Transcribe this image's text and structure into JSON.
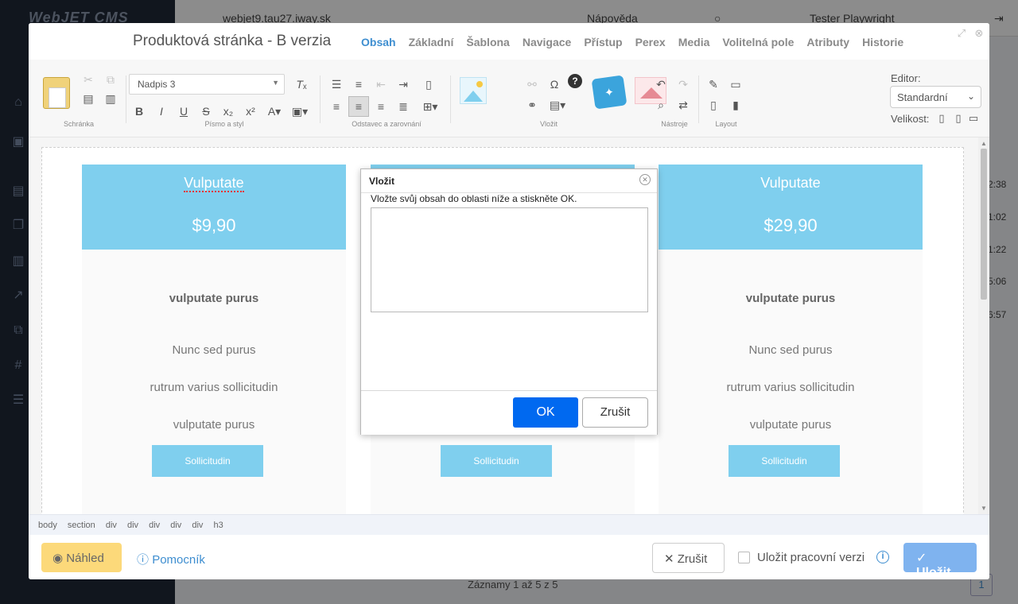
{
  "background": {
    "logo": "WebJET CMS",
    "host": "webjet9.tau27.iway.sk",
    "help": "Nápověda",
    "user": "Tester Playwright",
    "row_times": [
      "2:38",
      "1:02",
      "1:22",
      "5:06",
      "6:57"
    ],
    "records": "Záznamy 1 až 5 z 5",
    "page_number": "1"
  },
  "modal": {
    "title": "Produktová stránka - B verzia",
    "tabs": [
      {
        "label": "Obsah",
        "active": true
      },
      {
        "label": "Základní"
      },
      {
        "label": "Šablona"
      },
      {
        "label": "Navigace"
      },
      {
        "label": "Přístup"
      },
      {
        "label": "Perex"
      },
      {
        "label": "Media"
      },
      {
        "label": "Volitelná pole"
      },
      {
        "label": "Atributy"
      },
      {
        "label": "Historie"
      }
    ]
  },
  "toolbar": {
    "groups": {
      "clipboard": "Schránka",
      "font": "Písmo a styl",
      "paragraph": "Odstavec a zarovnání",
      "insert": "Vložit",
      "tools": "Nástroje",
      "layout": "Layout"
    },
    "format_value": "Nadpis 3",
    "editor_label": "Editor:",
    "editor_value": "Standardní",
    "size_label": "Velikost:"
  },
  "cards": [
    {
      "name": "Vulputate",
      "price": "$9,90",
      "feature": "vulputate purus",
      "items": [
        "Nunc sed purus",
        "rutrum varius sollicitudin",
        "vulputate purus"
      ],
      "button": "Sollicitudin"
    },
    {
      "name": "",
      "price": "",
      "feature": "",
      "items": [
        "",
        "",
        ""
      ],
      "button": "Sollicitudin"
    },
    {
      "name": "Vulputate",
      "price": "$29,90",
      "feature": "vulputate purus",
      "items": [
        "Nunc sed purus",
        "rutrum varius sollicitudin",
        "vulputate purus"
      ],
      "button": "Sollicitudin"
    }
  ],
  "path": [
    "body",
    "section",
    "div",
    "div",
    "div",
    "div",
    "div",
    "h3"
  ],
  "footer": {
    "preview": "Náhled",
    "helper": "Pomocník",
    "cancel": "Zrušit",
    "working_version": "Uložit pracovní verzi",
    "save": "Uložit"
  },
  "dialog": {
    "title": "Vložit",
    "text": "Vložte svůj obsah do oblasti níže a stiskněte OK.",
    "ok": "OK",
    "cancel": "Zrušit"
  },
  "colors": {
    "accent": "#3e8ed0",
    "card_header": "#7fcfee",
    "ok_button": "#0069f0",
    "preview_button": "#fcd97a",
    "save_button": "#7fb3ef"
  }
}
